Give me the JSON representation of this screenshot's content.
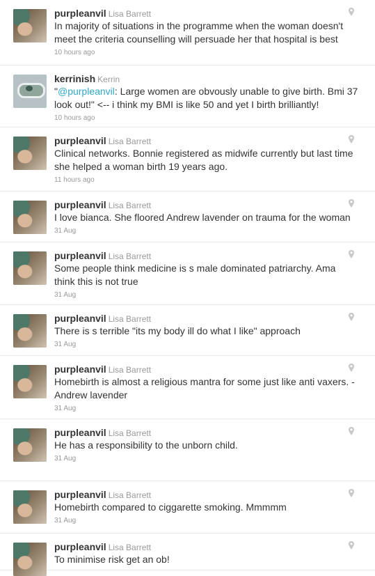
{
  "tweets": [
    {
      "screen_name": "purpleanvil",
      "full_name": "Lisa Barrett",
      "avatar": "lisa",
      "text": "In majority of situations in the programme when the woman doesn't meet the criteria counselling will persuade her that hospital is best",
      "time": "10 hours ago",
      "geo": true
    },
    {
      "screen_name": "kerrinish",
      "full_name": "Kerrin",
      "avatar": "kerrin",
      "text_prefix": "\"",
      "mention": "@purpleanvil",
      "text": ": Large women are obvously unable to give birth. Bmi 37 look out!\" <-- i think my BMI is like 50 and yet I birth brilliantly!",
      "time": "10 hours ago",
      "geo": false
    },
    {
      "screen_name": "purpleanvil",
      "full_name": "Lisa Barrett",
      "avatar": "lisa",
      "text": "Clinical networks. Bonnie registered as midwife currently but last time she helped a woman birth 19 years ago.",
      "time": "11 hours ago",
      "geo": true
    },
    {
      "screen_name": "purpleanvil",
      "full_name": "Lisa Barrett",
      "avatar": "lisa",
      "text": "I love bianca. She floored Andrew lavender on trauma for the woman",
      "time": "31 Aug",
      "geo": true
    },
    {
      "screen_name": "purpleanvil",
      "full_name": "Lisa Barrett",
      "avatar": "lisa",
      "text": "Some people think medicine is s male dominated patriarchy. Ama think this is not true",
      "time": "31 Aug",
      "geo": true
    },
    {
      "screen_name": "purpleanvil",
      "full_name": "Lisa Barrett",
      "avatar": "lisa",
      "text": "There is s terrible \"its my body ill do what I like\" approach",
      "time": "31 Aug",
      "geo": true
    },
    {
      "screen_name": "purpleanvil",
      "full_name": "Lisa Barrett",
      "avatar": "lisa",
      "text": "Homebirth is almost a religious mantra for some just like anti vaxers. - Andrew lavender",
      "time": "31 Aug",
      "geo": true
    },
    {
      "screen_name": "purpleanvil",
      "full_name": "Lisa Barrett",
      "avatar": "lisa",
      "text": "He has a responsibility to the unborn child.",
      "time": "31 Aug",
      "geo": true
    },
    {
      "screen_name": "purpleanvil",
      "full_name": "Lisa Barrett",
      "avatar": "lisa",
      "text": "Homebirth compared to ciggarette smoking. Mmmmm",
      "time": "31 Aug",
      "geo": true
    },
    {
      "screen_name": "purpleanvil",
      "full_name": "Lisa Barrett",
      "avatar": "lisa",
      "text": "To minimise risk get an ob!",
      "time": "",
      "geo": true
    }
  ],
  "icons": {
    "geo": "map-pin-icon"
  },
  "colors": {
    "mention": "#2fa8c8",
    "meta": "#999999",
    "text": "#333333",
    "divider": "#e8e8e8"
  }
}
